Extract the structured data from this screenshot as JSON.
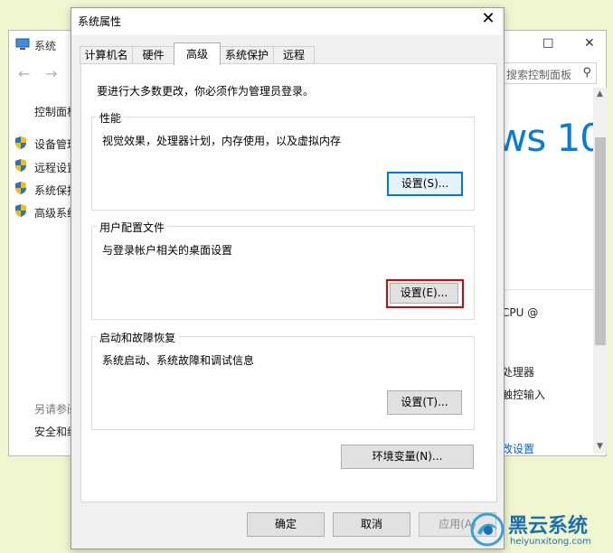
{
  "background_window": {
    "title": "系统",
    "search_placeholder": "搜索控制面板",
    "nav_back": "←",
    "nav_forward": "→",
    "breadcrumb": "控制面板",
    "left_links": [
      "设备管理器",
      "远程设置",
      "系统保护",
      "高级系统设置"
    ],
    "see_also_label": "另请参阅",
    "see_also_link": "安全和维护",
    "brand_text": "ws 10",
    "cpu_text": "CPU @",
    "processor_text": "处理器",
    "touch_text": "触控输入",
    "change_settings_link": "改设置",
    "min_glyph": "—",
    "max_glyph": "☐",
    "close_glyph": "✕"
  },
  "dialog": {
    "title": "系统属性",
    "close_glyph": "✕",
    "tabs": [
      "计算机名",
      "硬件",
      "高级",
      "系统保护",
      "远程"
    ],
    "active_tab": "高级",
    "admin_notice": "要进行大多数更改，你必须作为管理员登录。",
    "groups": {
      "performance": {
        "legend": "性能",
        "description": "视觉效果，处理器计划，内存使用，以及虚拟内存",
        "button": "设置(S)..."
      },
      "user_profiles": {
        "legend": "用户配置文件",
        "description": "与登录帐户相关的桌面设置",
        "button": "设置(E)..."
      },
      "startup_recovery": {
        "legend": "启动和故障恢复",
        "description": "系统启动、系统故障和调试信息",
        "button": "设置(T)..."
      }
    },
    "env_button": "环境变量(N)...",
    "ok_button": "确定",
    "cancel_button": "取消",
    "apply_button": "应用(A)"
  },
  "watermark": {
    "title": "黑云系统",
    "url": "heiyunxitong.com"
  },
  "colors": {
    "desktop": "#f0f6cf",
    "focus_blue": "#0078d7",
    "highlight_red": "#e00000",
    "brand_blue": "#0a7ad8"
  }
}
